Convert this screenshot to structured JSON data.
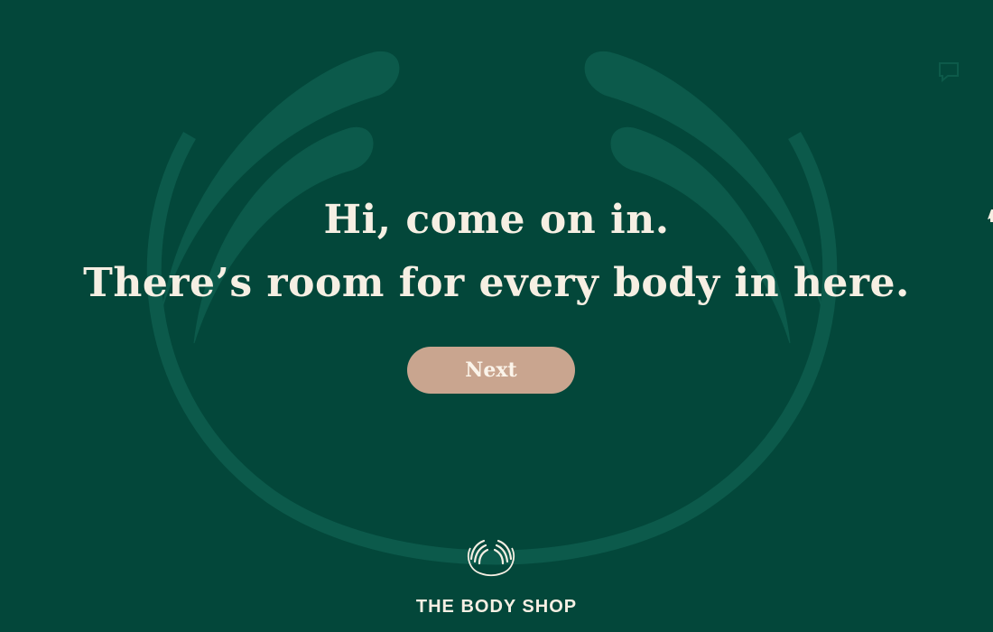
{
  "theme": {
    "background": "#03473a",
    "emblem_color": "#0c5a4b",
    "text_color": "#f6efe3",
    "button_color": "#c9a58f",
    "button_text_color": "#fbf4ea",
    "faint_icon_color": "#0d5a4a"
  },
  "welcome": {
    "headline_line_1": "Hi, come on in.",
    "headline_line_2": "There’s room for every body in here.",
    "next_label": "Next"
  },
  "brand": {
    "name": "THE BODY SHOP",
    "logo_icon": "leaf-wreath-icon",
    "background_icon": "leaf-wreath-icon"
  },
  "corner": {
    "icon": "chat-icon"
  }
}
